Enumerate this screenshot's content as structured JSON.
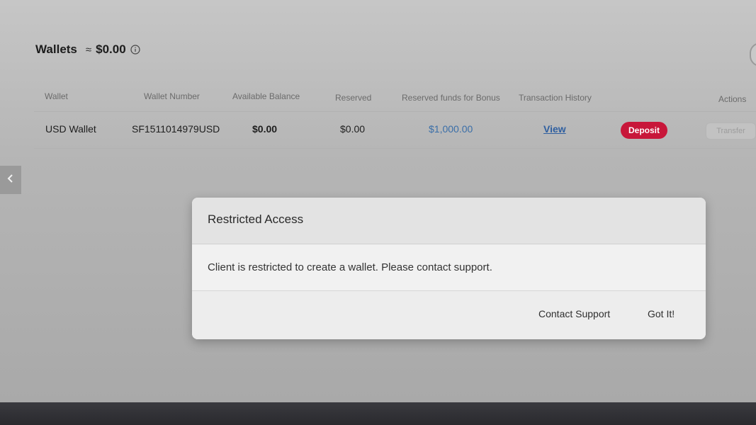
{
  "header": {
    "title": "Wallets",
    "approx_symbol": "≈",
    "total": "$0.00"
  },
  "table": {
    "columns": [
      "Wallet",
      "Wallet Number",
      "Available Balance",
      "Reserved",
      "Reserved funds for Bonus",
      "Transaction History",
      "Actions"
    ],
    "rows": [
      {
        "wallet": "USD Wallet",
        "wallet_number": "SF1511014979USD",
        "available_balance": "$0.00",
        "reserved": "$0.00",
        "reserved_bonus": "$1,000.00",
        "history_link": "View",
        "deposit_label": "Deposit",
        "transfer_label": "Transfer"
      }
    ]
  },
  "modal": {
    "title": "Restricted Access",
    "message": "Client is restricted to create a wallet. Please contact support.",
    "contact_label": "Contact Support",
    "ok_label": "Got It!"
  },
  "colors": {
    "deposit": "#c8173a",
    "link": "#2f5fa0"
  },
  "icons": {
    "info": "info-icon",
    "back": "chevron-left-icon"
  }
}
